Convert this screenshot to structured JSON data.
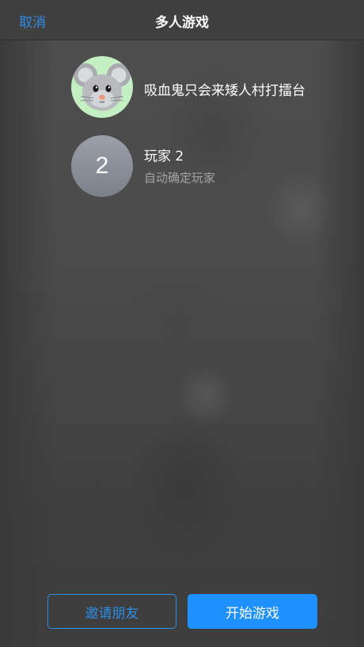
{
  "header": {
    "cancel_label": "取消",
    "title": "多人游戏"
  },
  "players": [
    {
      "name": "吸血鬼只会来矮人村打擂台",
      "avatar_icon": "mouse-memoji"
    },
    {
      "avatar_text": "2",
      "name": "玩家 2",
      "status": "自动确定玩家"
    }
  ],
  "buttons": {
    "invite_label": "邀请朋友",
    "start_label": "开始游戏"
  },
  "colors": {
    "accent": "#2e8ce6",
    "primary_button": "#1e90ff"
  }
}
